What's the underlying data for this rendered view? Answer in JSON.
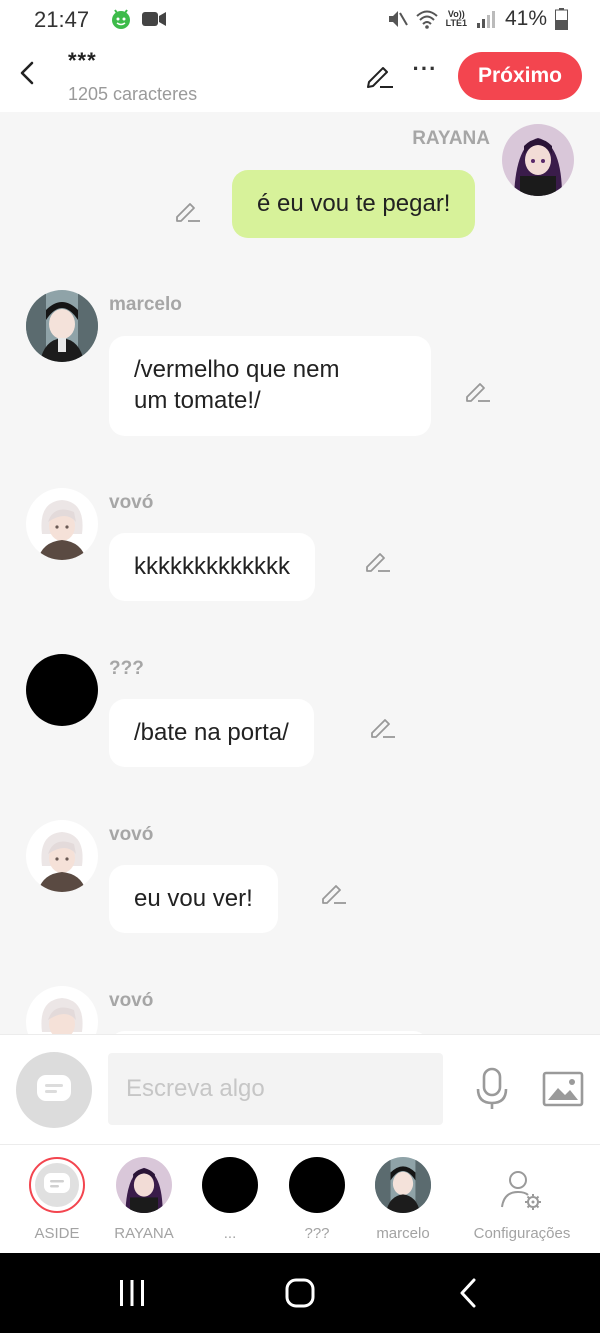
{
  "status_bar": {
    "time": "21:47",
    "battery": "41%",
    "network": "LTE1",
    "volte": "Vo))"
  },
  "header": {
    "title": "***",
    "char_count": "1205 caracteres",
    "next_label": "Próximo",
    "more_label": "···"
  },
  "messages": [
    {
      "sender": "RAYANA",
      "text": "é eu vou te pegar!",
      "side": "right"
    },
    {
      "sender": "marcelo",
      "text": "/vermelho que nem\num tomate!/",
      "side": "left"
    },
    {
      "sender": "vovó",
      "text": "kkkkkkkkkkkkk",
      "side": "left"
    },
    {
      "sender": "???",
      "text": "/bate na porta/",
      "side": "left"
    },
    {
      "sender": "vovó",
      "text": "eu vou ver!",
      "side": "left"
    },
    {
      "sender": "vovó",
      "text": "",
      "side": "left"
    }
  ],
  "input": {
    "placeholder": "Escreva algo"
  },
  "tabs": [
    {
      "label": "ASIDE"
    },
    {
      "label": "RAYANA"
    },
    {
      "label": "..."
    },
    {
      "label": "???"
    },
    {
      "label": "marcelo"
    },
    {
      "label": "Configurações"
    }
  ],
  "colors": {
    "accent": "#f3454f",
    "my_bubble": "#d7f29a",
    "background": "#f6f6f6"
  },
  "icons": [
    "back-arrow-icon",
    "pencil-icon",
    "more-icon",
    "chat-bubble-icon",
    "microphone-icon",
    "image-icon",
    "user-settings-icon"
  ]
}
